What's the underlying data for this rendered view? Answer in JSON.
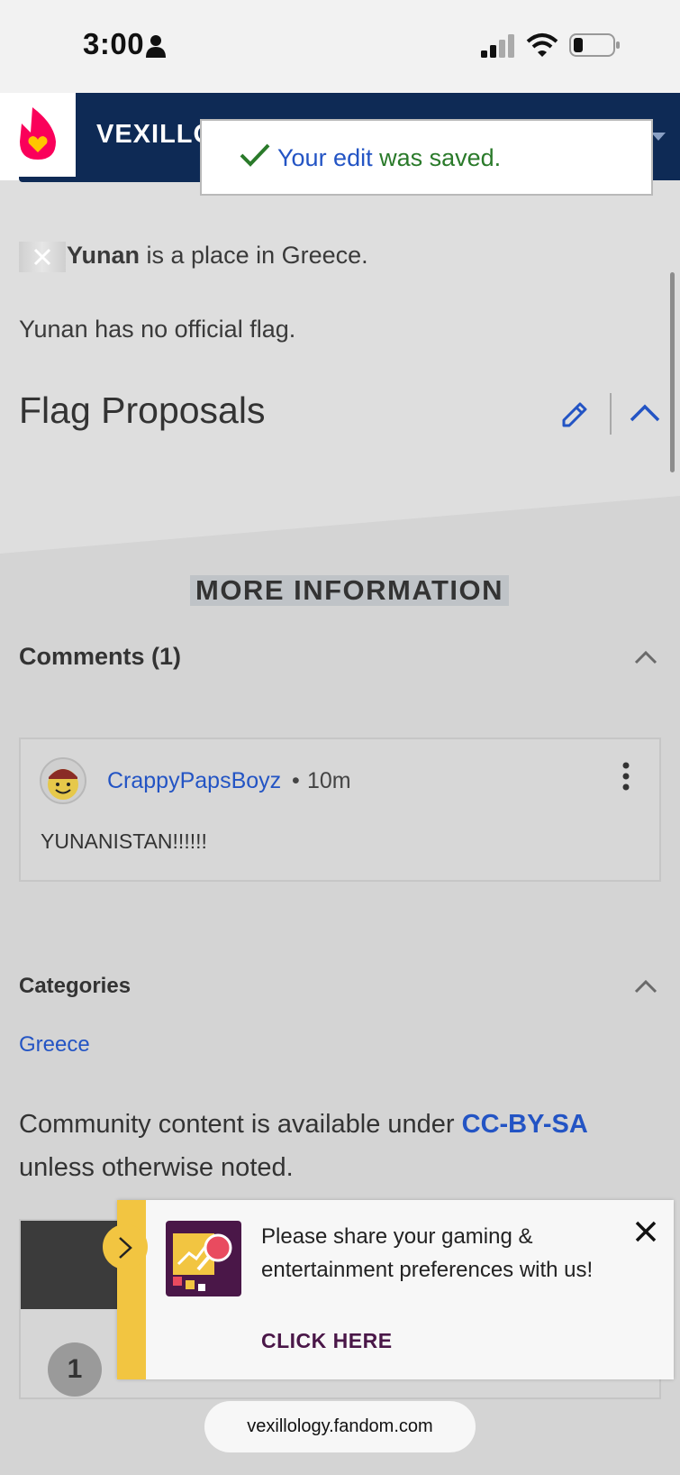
{
  "status_bar": {
    "time": "3:00"
  },
  "header": {
    "site_title": "VEXILLO"
  },
  "toast": {
    "prefix": "Your edit",
    "suffix": " was saved."
  },
  "article": {
    "intro_bold": "Yunan",
    "intro_rest": " is a place in Greece.",
    "no_flag": "Yunan has no official flag.",
    "section_title": "Flag Proposals"
  },
  "more_info": {
    "heading": "MORE INFORMATION"
  },
  "comments": {
    "heading": "Comments (1)",
    "items": [
      {
        "author": "CrappyPapsBoyz",
        "separator": "•",
        "time": "10m",
        "text": "YUNANISTAN!!!!!!"
      }
    ]
  },
  "categories": {
    "heading": "Categories",
    "items": [
      "Greece"
    ]
  },
  "license": {
    "prefix": "Community content is available under ",
    "link": "CC-BY-SA",
    "suffix": " unless otherwise noted."
  },
  "hidden_card": {
    "number": "1"
  },
  "banner": {
    "text": "Please share your gaming & entertainment preferences with us!",
    "cta": "CLICK HERE"
  },
  "browser": {
    "url": "vexillology.fandom.com"
  },
  "colors": {
    "header": "#0e2a55",
    "link": "#2354c4",
    "success": "#2a7a2a",
    "banner_accent": "#f2c541",
    "cta": "#4a1748"
  }
}
